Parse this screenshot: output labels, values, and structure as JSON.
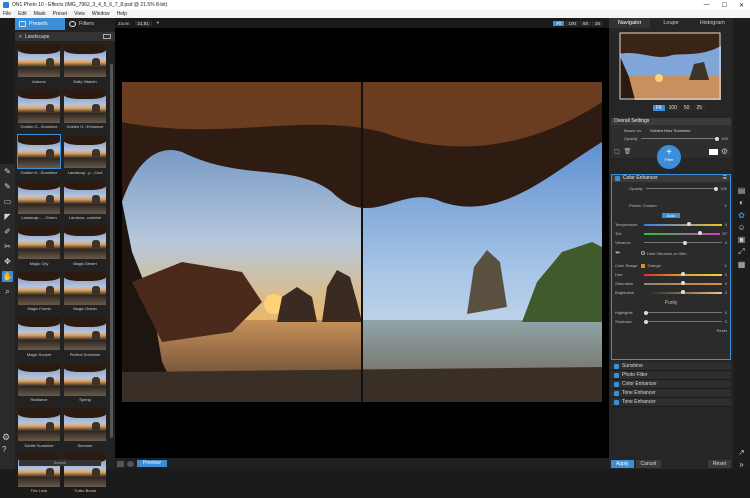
{
  "window": {
    "title": "ON1 Photo 10 - Effects (IMG_7962_3_4_5_6_7_8.psd @ 21.5% 8-bit)",
    "minimize": "—",
    "maximize": "☐",
    "close": "✕"
  },
  "menu": [
    "File",
    "Edit",
    "Mask",
    "Preset",
    "View",
    "Window",
    "Help"
  ],
  "left_panel": {
    "tabs": [
      {
        "label": "Presets",
        "active": true
      },
      {
        "label": "Filters",
        "active": false
      }
    ],
    "category": "Landscape",
    "thumbnails": [
      {
        "label": "Autumn"
      },
      {
        "label": "Daily Vitamin"
      },
      {
        "label": "Golden G...Sunshine"
      },
      {
        "label": "Golden H...Enhancer"
      },
      {
        "label": "Golden H...Sunshine",
        "selected": true
      },
      {
        "label": "Landscap...p - Cool"
      },
      {
        "label": "Landscap... - Green"
      },
      {
        "label": "Landsca...unshine"
      },
      {
        "label": "Magic City"
      },
      {
        "label": "Magic Desert"
      },
      {
        "label": "Magic Forest"
      },
      {
        "label": "Magic Ocean"
      },
      {
        "label": "Magic Sunset"
      },
      {
        "label": "Perfect Sunshine"
      },
      {
        "label": "Radiance"
      },
      {
        "label": "Spring"
      },
      {
        "label": "Subtle Sunshine"
      },
      {
        "label": "Summer"
      },
      {
        "label": "The Look"
      },
      {
        "label": "Turbo Boost"
      }
    ],
    "search_placeholder": "Search"
  },
  "toolbar": {
    "zoom_label": "Zoom",
    "zoom_value": "21.51",
    "zoom_buttons": [
      {
        "label": "Fit",
        "active": true
      },
      {
        "label": "100"
      },
      {
        "label": "50"
      },
      {
        "label": "25"
      }
    ]
  },
  "bottom": {
    "preview_label": "Preview"
  },
  "right_panel": {
    "nav_tabs": [
      {
        "label": "Navigator",
        "active": true
      },
      {
        "label": "Loupe"
      },
      {
        "label": "Histogram"
      }
    ],
    "nav_zoom": [
      {
        "label": "Fit",
        "active": true
      },
      {
        "label": "100"
      },
      {
        "label": "50"
      },
      {
        "label": "25"
      }
    ],
    "overall": {
      "title": "Overall Settings",
      "based_on_label": "Based on:",
      "based_on_value": "Golden Hour Sunshine",
      "opacity_label": "Opacity",
      "opacity_value": "100"
    },
    "filter_button": "Filter",
    "color_enhancer": {
      "title": "Color Enhancer",
      "opacity_label": "Opacity",
      "opacity_value": "100",
      "preset_label": "Preset: Custom",
      "auto_label": "Auto",
      "sliders": [
        {
          "label": "Temperature",
          "value": "0",
          "pos": 0.55
        },
        {
          "label": "Tint",
          "value": "57",
          "pos": 0.72
        },
        {
          "label": "Vibrance",
          "value": "0",
          "pos": 0.5
        }
      ],
      "limit_label": "Limit Vibrance on Skin",
      "color_range_label": "Color Range",
      "color_range_value": "Orange",
      "range_sliders": [
        {
          "label": "Hue",
          "value": "0",
          "pos": 0.48
        },
        {
          "label": "Saturation",
          "value": "0",
          "pos": 0.48
        },
        {
          "label": "Brightness",
          "value": "0",
          "pos": 0.48
        }
      ],
      "purity_label": "Purity",
      "purity_sliders": [
        {
          "label": "Highlights",
          "value": "0",
          "pos": 0.0
        },
        {
          "label": "Shadows",
          "value": "0",
          "pos": 0.0
        }
      ],
      "reset_label": "Reset"
    },
    "stack": [
      "Sunshine",
      "Photo Filter",
      "Color Enhancer",
      "Tone Enhancer",
      "Tone Enhancer"
    ],
    "apply_label": "Apply",
    "cancel_label": "Cancel",
    "reset_label": "Reset"
  },
  "colors": {
    "accent": "#3a8fd8",
    "panel": "#262626",
    "canvas": "#000000"
  }
}
